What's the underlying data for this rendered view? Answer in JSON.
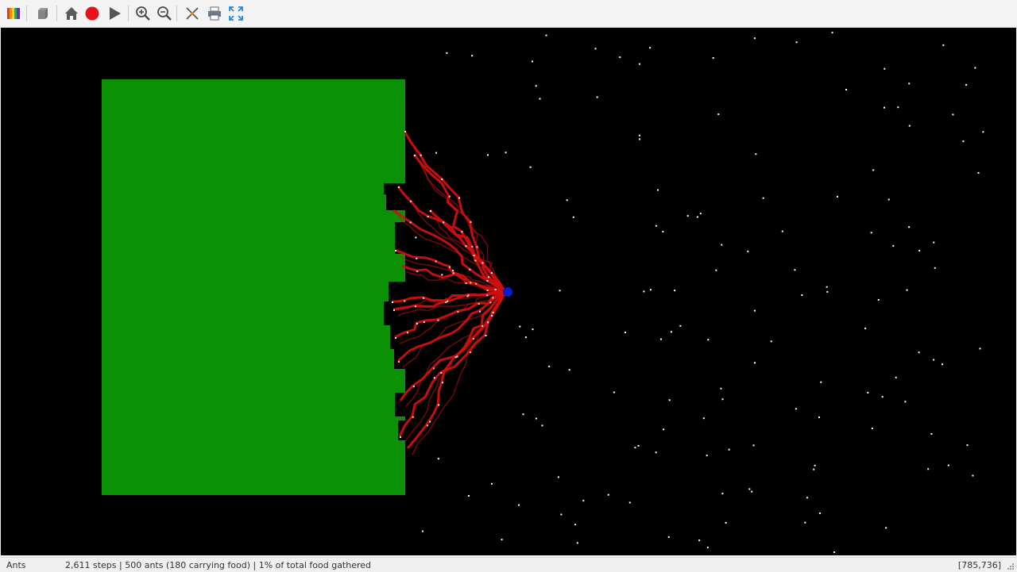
{
  "toolbar": {
    "icons": [
      "palette-icon",
      "cube-icon",
      "home-icon",
      "record-icon",
      "play-icon",
      "zoom-in-icon",
      "zoom-out-icon",
      "crosshair-icon",
      "print-icon",
      "fullscreen-icon"
    ]
  },
  "simulation": {
    "colors": {
      "background": "#000000",
      "food": "#0a9106",
      "trail": "#d01010",
      "nest": "#0a1ad0",
      "ant": "#ffffff"
    }
  },
  "status": {
    "name": "Ants",
    "text": "2,611 steps | 500 ants (180 carrying food) | 1% of total food gathered",
    "coords": "[785,736]"
  }
}
